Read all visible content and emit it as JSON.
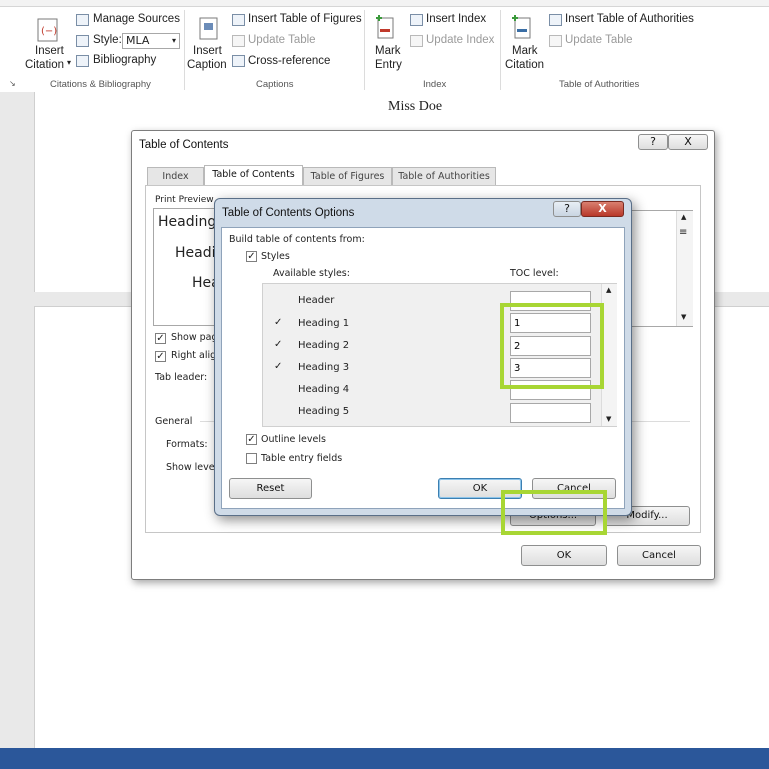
{
  "ribbon": {
    "citations": {
      "insert_citation_1": "Insert",
      "insert_citation_2": "Citation",
      "manage_sources": "Manage Sources",
      "style_label": "Style:",
      "style_value": "MLA",
      "bibliography": "Bibliography",
      "group": "Citations & Bibliography"
    },
    "captions": {
      "insert_caption_1": "Insert",
      "insert_caption_2": "Caption",
      "insert_table_of_figures": "Insert Table of Figures",
      "update_table": "Update Table",
      "cross_reference": "Cross-reference",
      "group": "Captions"
    },
    "index": {
      "mark_entry_1": "Mark",
      "mark_entry_2": "Entry",
      "insert_index": "Insert Index",
      "update_index": "Update Index",
      "group": "Index"
    },
    "authorities": {
      "mark_citation_1": "Mark",
      "mark_citation_2": "Citation",
      "insert_table_of_authorities": "Insert Table of Authorities",
      "update_table": "Update Table",
      "group": "Table of Authorities"
    }
  },
  "document": {
    "author": "Miss Doe"
  },
  "toc_dialog": {
    "title": "Table of Contents",
    "tabs": [
      "Index",
      "Table of Contents",
      "Table of Figures",
      "Table of Authorities"
    ],
    "print_preview_label": "Print Preview",
    "preview_lines": [
      "Heading",
      "Headi",
      "Hea"
    ],
    "show_page_numbers": "Show pag",
    "right_align": "Right alig",
    "tab_leader": "Tab leader:",
    "general": "General",
    "formats": "Formats:",
    "show_levels": "Show levels",
    "options_button": "Options...",
    "modify_button": "Modify...",
    "ok_button": "OK",
    "cancel_button": "Cancel"
  },
  "options_dialog": {
    "title": "Table of Contents Options",
    "build_from": "Build table of contents from:",
    "styles_label": "Styles",
    "available_styles": "Available styles:",
    "toc_level": "TOC level:",
    "styles": [
      {
        "name": "Header",
        "checked": "",
        "level": ""
      },
      {
        "name": "Heading 1",
        "checked": "✓",
        "level": "1"
      },
      {
        "name": "Heading 2",
        "checked": "✓",
        "level": "2"
      },
      {
        "name": "Heading 3",
        "checked": "✓",
        "level": "3"
      },
      {
        "name": "Heading 4",
        "checked": "",
        "level": ""
      },
      {
        "name": "Heading 5",
        "checked": "",
        "level": ""
      }
    ],
    "outline_levels": "Outline levels",
    "table_entry_fields": "Table entry fields",
    "reset_button": "Reset",
    "ok_button": "OK",
    "cancel_button": "Cancel",
    "help_glyph": "?",
    "close_glyph": "X"
  },
  "colors": {
    "highlight": "#a8d634",
    "statusbar": "#2b579a",
    "close_button": "#c94a3c"
  }
}
